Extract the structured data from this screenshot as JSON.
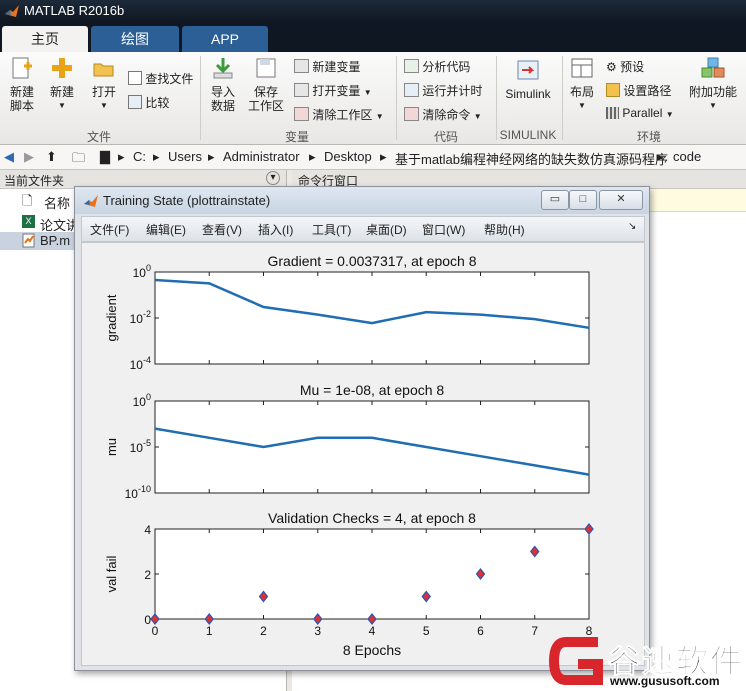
{
  "window": {
    "title": "MATLAB R2016b"
  },
  "tabs": [
    {
      "label": "主页",
      "active": true
    },
    {
      "label": "绘图",
      "active": false
    },
    {
      "label": "APP",
      "active": false
    }
  ],
  "ribbon": {
    "file_group": {
      "label": "文件",
      "new_script": [
        "新建",
        "脚本"
      ],
      "new": "新建",
      "open": "打开",
      "find_files": "查找文件",
      "compare": "比较"
    },
    "variable_group": {
      "label": "变量",
      "import": [
        "导入",
        "数据"
      ],
      "save_ws": [
        "保存",
        "工作区"
      ],
      "new_var": "新建变量",
      "open_var": "打开变量",
      "clear_ws": "清除工作区"
    },
    "code_group": {
      "label": "代码",
      "analyze": "分析代码",
      "run_time": "运行并计时",
      "clear_cmd": "清除命令"
    },
    "simulink_group": {
      "label": "SIMULINK",
      "simulink": "Simulink"
    },
    "env_group": {
      "label": "环境",
      "layout": "布局",
      "prefs": "预设",
      "set_path": "设置路径",
      "parallel": "Parallel",
      "addons": "附加功能"
    }
  },
  "address": {
    "segments": [
      "C:",
      "Users",
      "Administrator",
      "Desktop",
      "基于matlab编程神经网络的缺失数仿真源码程序",
      "code"
    ]
  },
  "left_panel": {
    "title": "当前文件夹",
    "column": "名称",
    "files": [
      {
        "name": "论文讲",
        "icon": "excel-icon"
      },
      {
        "name": "BP.m",
        "icon": "matlab-script-icon"
      }
    ]
  },
  "command_window": {
    "title": "命令行窗口"
  },
  "figure": {
    "title": "Training State (plottrainstate)",
    "menu": [
      "文件(F)",
      "编辑(E)",
      "查看(V)",
      "插入(I)",
      "工具(T)",
      "桌面(D)",
      "窗口(W)",
      "帮助(H)"
    ],
    "buttons": {
      "minimize": "▭",
      "maximize": "□",
      "close": "✕"
    }
  },
  "watermark": {
    "brand": "谷速软件",
    "url": "www.gususoft.com"
  },
  "colors": {
    "line": "#1f6db2",
    "marker_face": "#e03030",
    "marker_edge": "#2a55b5"
  },
  "chart_data": [
    {
      "type": "line",
      "title": "Gradient = 0.0037317, at epoch 8",
      "ylabel": "gradient",
      "yscale": "log",
      "ylim": [
        0.0001,
        1
      ],
      "yticks": [
        "10^0",
        "10^-2",
        "10^-4"
      ],
      "x": [
        0,
        1,
        2,
        3,
        4,
        5,
        6,
        7,
        8
      ],
      "y": [
        0.45,
        0.32,
        0.03,
        0.014,
        0.006,
        0.018,
        0.014,
        0.009,
        0.0037317
      ]
    },
    {
      "type": "line",
      "title": "Mu = 1e-08, at epoch 8",
      "ylabel": "mu",
      "yscale": "log",
      "ylim": [
        1e-10,
        1
      ],
      "yticks": [
        "10^0",
        "10^-5",
        "10^-10"
      ],
      "x": [
        0,
        1,
        2,
        3,
        4,
        5,
        6,
        7,
        8
      ],
      "y": [
        0.001,
        0.0001,
        1e-05,
        0.0001,
        0.0001,
        1e-05,
        1e-06,
        1e-07,
        1e-08
      ]
    },
    {
      "type": "scatter",
      "title": "Validation Checks = 4, at epoch 8",
      "ylabel": "val fail",
      "xlabel": "8 Epochs",
      "ylim": [
        0,
        4
      ],
      "yticks": [
        "4",
        "2",
        "0"
      ],
      "xticks": [
        "0",
        "1",
        "2",
        "3",
        "4",
        "5",
        "6",
        "7",
        "8"
      ],
      "x": [
        0,
        1,
        2,
        3,
        4,
        5,
        6,
        7,
        8
      ],
      "y": [
        0,
        0,
        1,
        0,
        0,
        1,
        2,
        3,
        4
      ]
    }
  ]
}
